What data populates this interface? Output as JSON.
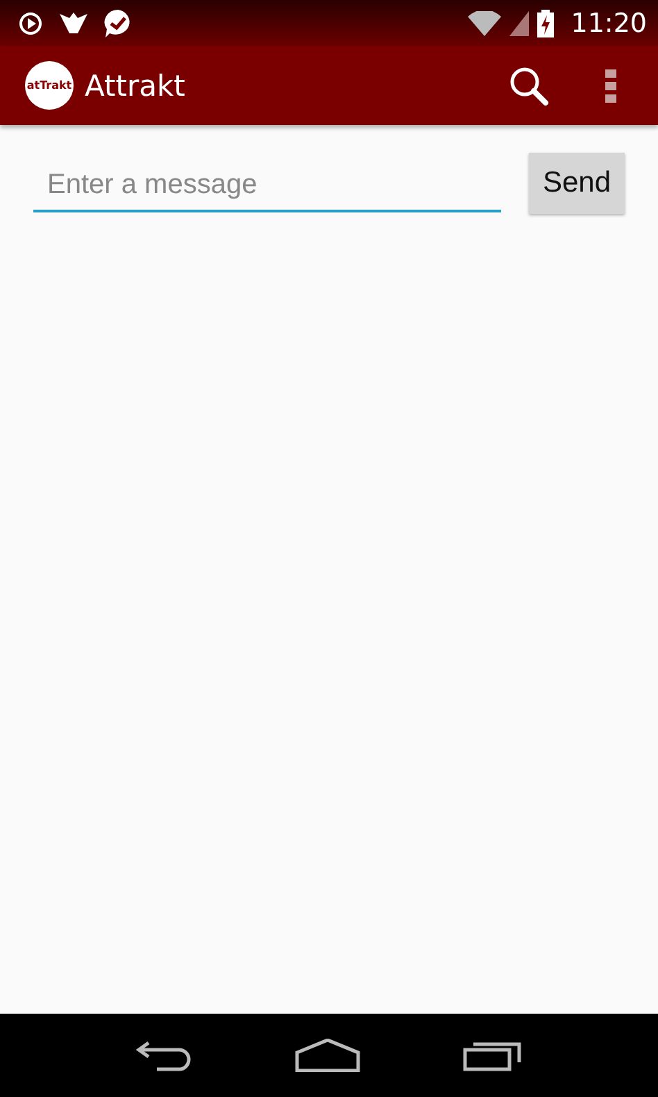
{
  "status_bar": {
    "time": "11:20"
  },
  "app_bar": {
    "logo_text": "atTrakt",
    "title": "Attrakt"
  },
  "composer": {
    "placeholder": "Enter a message",
    "send_label": "Send"
  }
}
